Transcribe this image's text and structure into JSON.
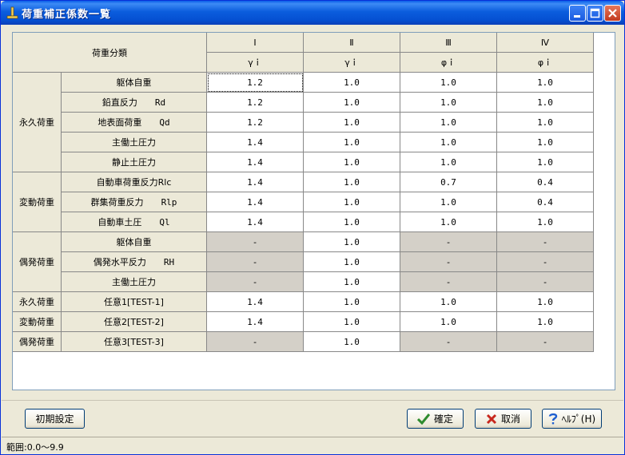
{
  "window": {
    "title": "荷重補正係数一覧"
  },
  "table": {
    "category_header": "荷重分類",
    "columns": [
      {
        "numeral": "Ⅰ",
        "symbol": "γｉ"
      },
      {
        "numeral": "Ⅱ",
        "symbol": "γｉ"
      },
      {
        "numeral": "Ⅲ",
        "symbol": "φｉ"
      },
      {
        "numeral": "Ⅳ",
        "symbol": "φｉ"
      }
    ],
    "groups": [
      {
        "label": "永久荷重",
        "rows": [
          {
            "name": "躯体自重",
            "symbol": "",
            "values": [
              "1.2",
              "1.0",
              "1.0",
              "1.0"
            ],
            "disabled": [
              false,
              false,
              false,
              false
            ]
          },
          {
            "name": "鉛直反力",
            "symbol": "Rd",
            "values": [
              "1.2",
              "1.0",
              "1.0",
              "1.0"
            ],
            "disabled": [
              false,
              false,
              false,
              false
            ]
          },
          {
            "name": "地表面荷重",
            "symbol": "Qd",
            "values": [
              "1.2",
              "1.0",
              "1.0",
              "1.0"
            ],
            "disabled": [
              false,
              false,
              false,
              false
            ]
          },
          {
            "name": "主働土圧力",
            "symbol": "",
            "values": [
              "1.4",
              "1.0",
              "1.0",
              "1.0"
            ],
            "disabled": [
              false,
              false,
              false,
              false
            ]
          },
          {
            "name": "静止土圧力",
            "symbol": "",
            "values": [
              "1.4",
              "1.0",
              "1.0",
              "1.0"
            ],
            "disabled": [
              false,
              false,
              false,
              false
            ]
          }
        ]
      },
      {
        "label": "変動荷重",
        "rows": [
          {
            "name": "自動車荷重反力Rlc",
            "symbol": "",
            "values": [
              "1.4",
              "1.0",
              "0.7",
              "0.4"
            ],
            "disabled": [
              false,
              false,
              false,
              false
            ]
          },
          {
            "name": "群集荷重反力",
            "symbol": "Rlp",
            "values": [
              "1.4",
              "1.0",
              "1.0",
              "0.4"
            ],
            "disabled": [
              false,
              false,
              false,
              false
            ]
          },
          {
            "name": "自動車土圧",
            "symbol": "Ql",
            "values": [
              "1.4",
              "1.0",
              "1.0",
              "1.0"
            ],
            "disabled": [
              false,
              false,
              false,
              false
            ]
          }
        ]
      },
      {
        "label": "偶発荷重",
        "rows": [
          {
            "name": "躯体自重",
            "symbol": "",
            "values": [
              "-",
              "1.0",
              "-",
              "-"
            ],
            "disabled": [
              true,
              false,
              true,
              true
            ]
          },
          {
            "name": "偶発水平反力",
            "symbol": "RH",
            "values": [
              "-",
              "1.0",
              "-",
              "-"
            ],
            "disabled": [
              true,
              false,
              true,
              true
            ]
          },
          {
            "name": "主働土圧力",
            "symbol": "",
            "values": [
              "-",
              "1.0",
              "-",
              "-"
            ],
            "disabled": [
              true,
              false,
              true,
              true
            ]
          }
        ]
      },
      {
        "label": "永久荷重",
        "rows": [
          {
            "name": "任意1[TEST-1]",
            "symbol": "",
            "values": [
              "1.4",
              "1.0",
              "1.0",
              "1.0"
            ],
            "disabled": [
              false,
              false,
              false,
              false
            ]
          }
        ]
      },
      {
        "label": "変動荷重",
        "rows": [
          {
            "name": "任意2[TEST-2]",
            "symbol": "",
            "values": [
              "1.4",
              "1.0",
              "1.0",
              "1.0"
            ],
            "disabled": [
              false,
              false,
              false,
              false
            ]
          }
        ]
      },
      {
        "label": "偶発荷重",
        "rows": [
          {
            "name": "任意3[TEST-3]",
            "symbol": "",
            "values": [
              "-",
              "1.0",
              "-",
              "-"
            ],
            "disabled": [
              true,
              false,
              true,
              true
            ]
          }
        ]
      }
    ]
  },
  "buttons": {
    "init": "初期設定",
    "ok": "確定",
    "cancel": "取消",
    "help": "ﾍﾙﾌﾟ(H)"
  },
  "status": {
    "text": "範囲:0.0～9.9"
  },
  "icons": {
    "ok": "check-icon",
    "cancel": "x-icon",
    "help": "question-icon"
  },
  "colors": {
    "titlebar": "#0b5ddd",
    "disabled_cell": "#d4d0c8",
    "ok_icon": "#2e8b2e",
    "cancel_icon": "#c8281e",
    "help_icon": "#1f5fd0"
  }
}
